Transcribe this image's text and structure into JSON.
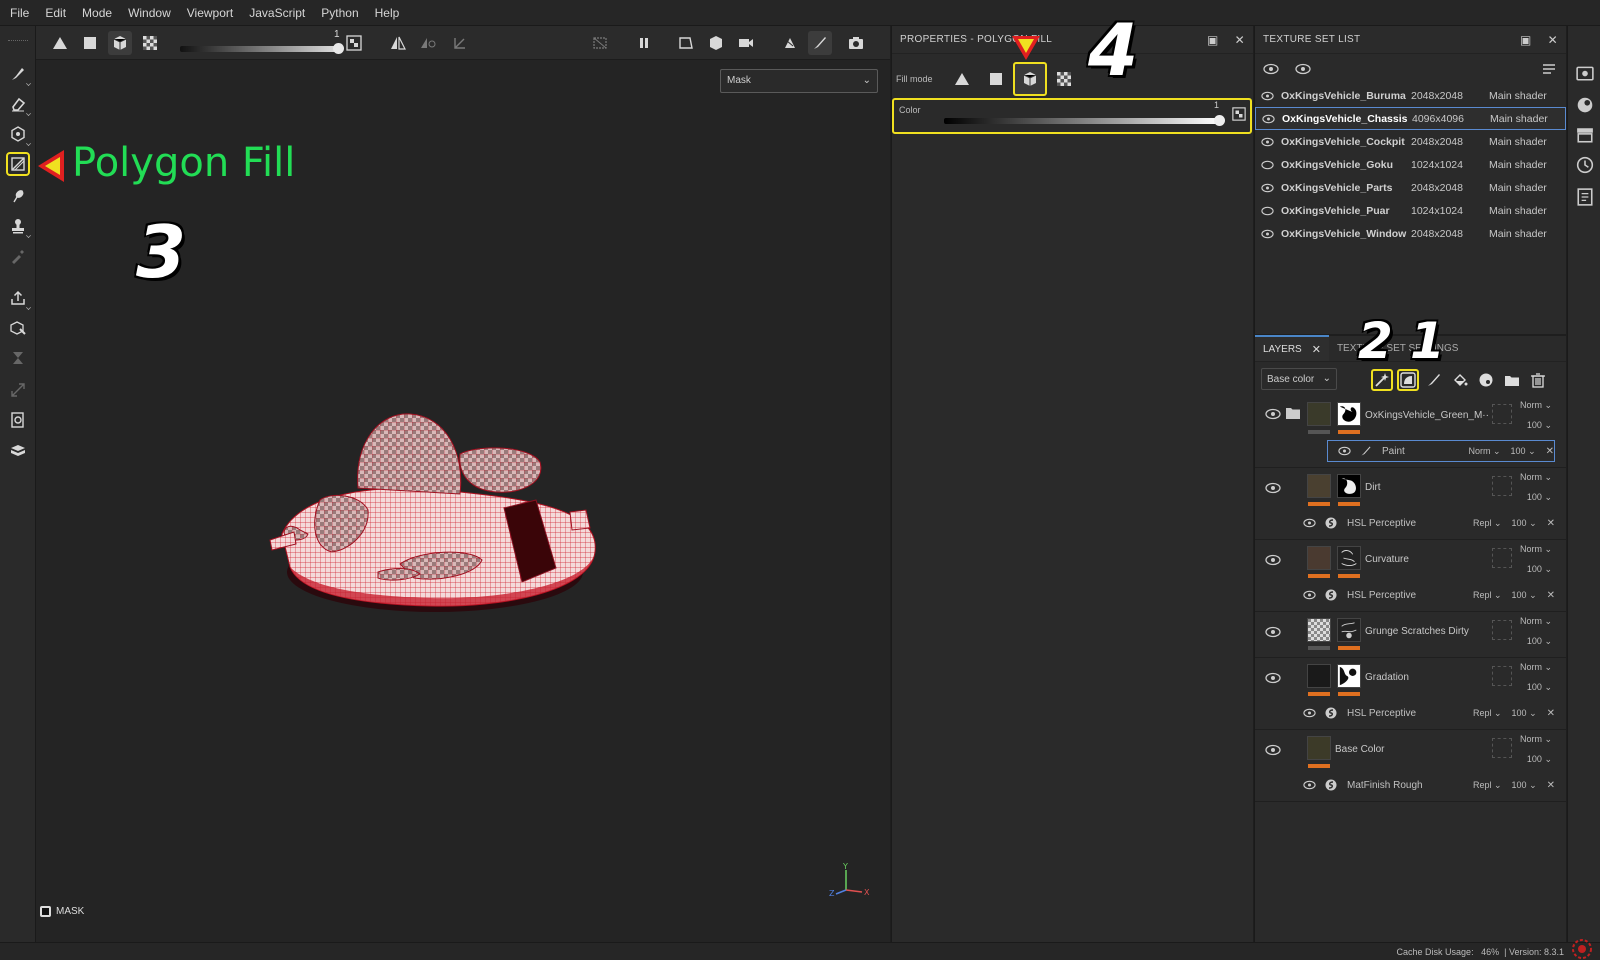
{
  "menu": [
    "File",
    "Edit",
    "Mode",
    "Window",
    "Viewport",
    "JavaScript",
    "Python",
    "Help"
  ],
  "viewport": {
    "slider_value": "1",
    "mask_dropdown": "Mask",
    "mask_label": "MASK",
    "axes": {
      "x": "X",
      "y": "Y",
      "z": "Z"
    }
  },
  "annotations": {
    "polygon_fill": "Polygon Fill",
    "step3": "3",
    "step4": "4",
    "step2": "2",
    "step1": "1"
  },
  "properties": {
    "title": "PROPERTIES - POLYGON FILL",
    "fill_mode_label": "Fill mode",
    "color_label": "Color",
    "color_value": "1"
  },
  "texture_set_list": {
    "title": "TEXTURE SET LIST",
    "rows": [
      {
        "name": "OxKingsVehicle_Buruma",
        "res": "2048x2048",
        "shader": "Main shader"
      },
      {
        "name": "OxKingsVehicle_Chassis",
        "res": "4096x4096",
        "shader": "Main shader"
      },
      {
        "name": "OxKingsVehicle_Cockpit",
        "res": "2048x2048",
        "shader": "Main shader"
      },
      {
        "name": "OxKingsVehicle_Goku",
        "res": "1024x1024",
        "shader": "Main shader"
      },
      {
        "name": "OxKingsVehicle_Parts",
        "res": "2048x2048",
        "shader": "Main shader"
      },
      {
        "name": "OxKingsVehicle_Puar",
        "res": "1024x1024",
        "shader": "Main shader"
      },
      {
        "name": "OxKingsVehicle_Window",
        "res": "2048x2048",
        "shader": "Main shader"
      }
    ]
  },
  "layers_panel": {
    "tab_layers": "LAYERS",
    "tab_tss": "TEXTURE SET SETTINGS",
    "channel": "Base color",
    "layers": [
      {
        "name": "OxKingsVehicle_Green_M··",
        "blend": "Norm",
        "opacity": "100",
        "sub": {
          "name": "Paint",
          "blend": "Norm",
          "opacity": "100"
        }
      },
      {
        "name": "Dirt",
        "blend": "Norm",
        "opacity": "100",
        "sub": {
          "name": "HSL Perceptive",
          "blend": "Repl",
          "opacity": "100"
        }
      },
      {
        "name": "Curvature",
        "blend": "Norm",
        "opacity": "100",
        "sub": {
          "name": "HSL Perceptive",
          "blend": "Repl",
          "opacity": "100"
        }
      },
      {
        "name": "Grunge Scratches Dirty",
        "blend": "Norm",
        "opacity": "100"
      },
      {
        "name": "Gradation",
        "blend": "Norm",
        "opacity": "100",
        "sub": {
          "name": "HSL Perceptive",
          "blend": "Repl",
          "opacity": "100"
        }
      },
      {
        "name": "Base Color",
        "blend": "Norm",
        "opacity": "100",
        "sub": {
          "name": "MatFinish Rough",
          "blend": "Repl",
          "opacity": "100"
        }
      }
    ]
  },
  "status": {
    "cache_label": "Cache Disk Usage:",
    "cache_value": "46%",
    "version": "Version: 8.3.1"
  },
  "colors": {
    "highlight": "#f0e020",
    "accent_green": "#22dd55",
    "selection_blue": "#5a8ad0",
    "layer_bar": "#e07020"
  }
}
